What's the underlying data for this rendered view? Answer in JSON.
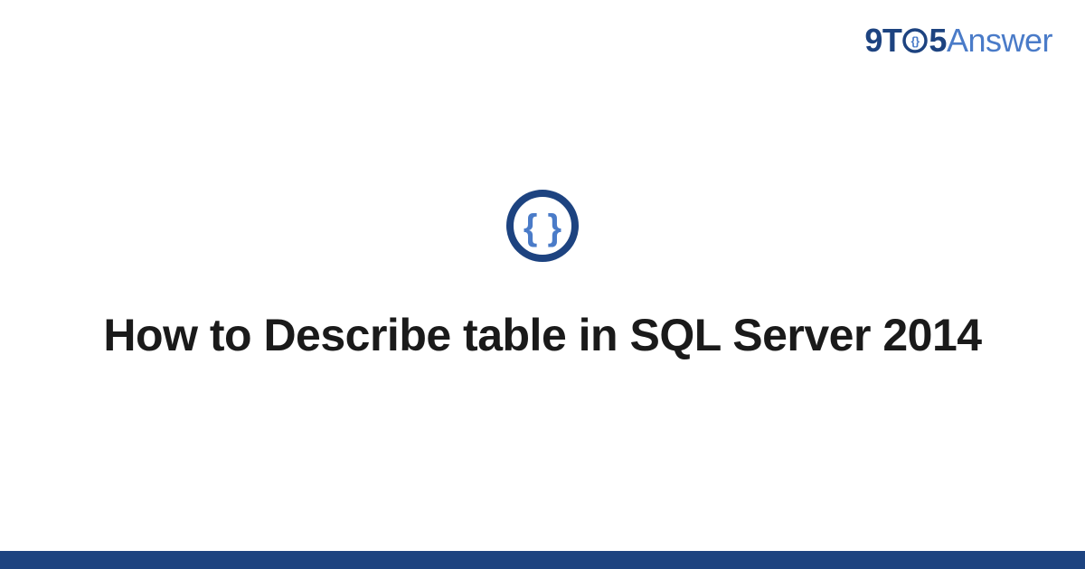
{
  "brand": {
    "nine": "9",
    "t": "T",
    "five": "5",
    "answer": "Answer"
  },
  "title": "How to Describe table in SQL Server 2014",
  "colors": {
    "brand_dark": "#1d4380",
    "brand_light": "#4a7bc8",
    "text": "#1a1a1a"
  }
}
